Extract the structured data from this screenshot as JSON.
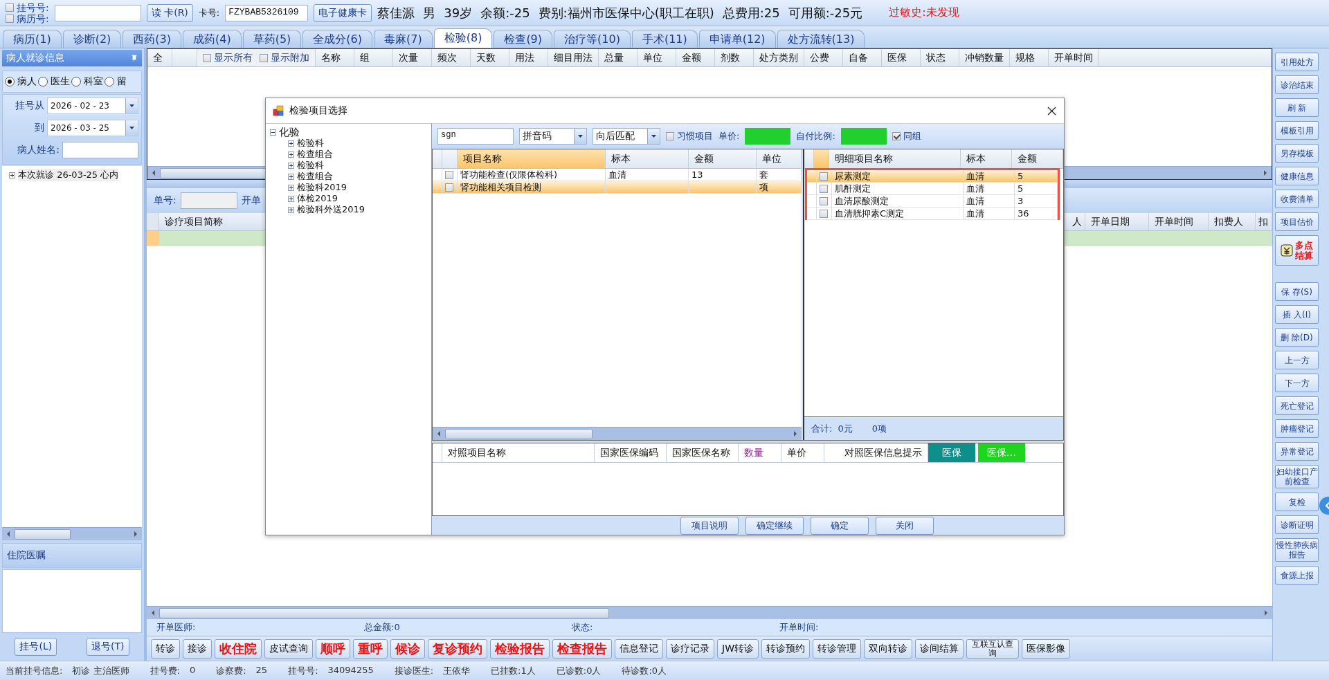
{
  "top_bar": {
    "checkboxes": [
      {
        "label": "挂号号:",
        "checked": false
      },
      {
        "label": "病历号:",
        "checked": false
      }
    ],
    "read_card_button": "读 卡(R)",
    "card_label": "卡号:",
    "card_number": "FZYBAB5326109",
    "health_card_button": "电子健康卡",
    "info_items": [
      "蔡佳源",
      "男",
      "39岁",
      "余额:-25",
      "费别:福州市医保中心(职工在职)",
      "总费用:25",
      "可用额:-25元"
    ],
    "allergy": "过敏史:未发现"
  },
  "tabs": [
    {
      "label": "病历(1)",
      "selected": false
    },
    {
      "label": "诊断(2)",
      "selected": false
    },
    {
      "label": "西药(3)",
      "selected": false
    },
    {
      "label": "成药(4)",
      "selected": false
    },
    {
      "label": "草药(5)",
      "selected": false
    },
    {
      "label": "全成分(6)",
      "selected": false
    },
    {
      "label": "毒麻(7)",
      "selected": false
    },
    {
      "label": "检验(8)",
      "selected": true
    },
    {
      "label": "检查(9)",
      "selected": false
    },
    {
      "label": "治疗等(10)",
      "selected": false
    },
    {
      "label": "手术(11)",
      "selected": false
    },
    {
      "label": "申请单(12)",
      "selected": false
    },
    {
      "label": "处方流转(13)",
      "selected": false
    }
  ],
  "left_panel": {
    "title": "病人就诊信息",
    "radios": [
      {
        "label": "病人",
        "selected": true
      },
      {
        "label": "医生",
        "selected": false
      },
      {
        "label": "科室",
        "selected": false
      },
      {
        "label": "留",
        "selected": false
      }
    ],
    "date_from_label": "挂号从",
    "date_from": "2026 - 02 - 23",
    "date_to_label": "到",
    "date_to": "2026 - 03 - 25",
    "name_label": "病人姓名:",
    "tree": [
      {
        "label": "本次就诊  26-03-25  心内",
        "expanded": false
      }
    ],
    "inpatient_title": "住院医嘱",
    "buttons": [
      "挂号(L)",
      "退号(T)"
    ]
  },
  "prescription_grid": {
    "select_all": "全",
    "toggles": [
      {
        "label": "显示所有",
        "checked": false
      },
      {
        "label": "显示附加",
        "checked": false
      }
    ],
    "columns": [
      "名称",
      "组",
      "次量",
      "频次",
      "天数",
      "用法",
      "细目用法",
      "总量",
      "单位",
      "金额",
      "剂数",
      "处方类别",
      "公费",
      "自备",
      "医保",
      "状态",
      "冲销数量",
      "规格",
      "开单时间"
    ]
  },
  "order_panel": {
    "number_label": "单号:",
    "doctor_label": "开单",
    "columns_left": [
      "诊疗项目简称"
    ],
    "columns_right": [
      "人",
      "开单日期",
      "开单时间",
      "扣费人",
      "扣"
    ],
    "rows": [
      {
        "selected": true
      }
    ],
    "summary": [
      "开单医师:",
      "总金额:0",
      "状态:",
      "开单时间:"
    ]
  },
  "action_buttons": [
    {
      "label": "转诊",
      "kind": "normal"
    },
    {
      "label": "接诊",
      "kind": "normal"
    },
    {
      "label": "收住院",
      "kind": "emphasis"
    },
    {
      "label": "皮试查询",
      "kind": "normal"
    },
    {
      "label": "顺呼",
      "kind": "emphasis"
    },
    {
      "label": "重呼",
      "kind": "emphasis"
    },
    {
      "label": "候诊",
      "kind": "emphasis"
    },
    {
      "label": "复诊预约",
      "kind": "emphasis"
    },
    {
      "label": "检验报告",
      "kind": "emphasis"
    },
    {
      "label": "检查报告",
      "kind": "emphasis"
    },
    {
      "label": "信息登记",
      "kind": "normal"
    },
    {
      "label": "诊疗记录",
      "kind": "normal"
    },
    {
      "label": "JW转诊",
      "kind": "normal"
    },
    {
      "label": "转诊预约",
      "kind": "normal"
    },
    {
      "label": "转诊管理",
      "kind": "normal"
    },
    {
      "label": "双向转诊",
      "kind": "normal"
    },
    {
      "label": "诊间结算",
      "kind": "normal"
    },
    {
      "label": "互联互认查询",
      "kind": "small"
    },
    {
      "label": "医保影像",
      "kind": "normal"
    }
  ],
  "side_buttons": [
    {
      "label": "引用处方",
      "kind": "button"
    },
    {
      "label": "诊治结束",
      "kind": "button"
    },
    {
      "label": "刷 新",
      "kind": "button"
    },
    {
      "label": "模板引用",
      "kind": "button"
    },
    {
      "label": "另存模板",
      "kind": "button"
    },
    {
      "label": "健康信息",
      "kind": "button"
    },
    {
      "label": "收费清单",
      "kind": "button"
    },
    {
      "label": "项目估价",
      "kind": "button"
    },
    {
      "label": "多点结算",
      "kind": "icon_button"
    },
    {
      "label": "保 存(S)",
      "kind": "button"
    },
    {
      "label": "插 入(I)",
      "kind": "button"
    },
    {
      "label": "删 除(D)",
      "kind": "button"
    },
    {
      "label": "上一方",
      "kind": "button"
    },
    {
      "label": "下一方",
      "kind": "button"
    },
    {
      "label": "死亡登记",
      "kind": "button"
    },
    {
      "label": "肿瘤登记",
      "kind": "button"
    },
    {
      "label": "异常登记",
      "kind": "button"
    },
    {
      "label": "妇幼接口产前检查",
      "kind": "button"
    },
    {
      "label": "复检",
      "kind": "button"
    },
    {
      "label": "诊断证明",
      "kind": "button"
    },
    {
      "label": "慢性肺疾病报告",
      "kind": "button"
    },
    {
      "label": "食源上报",
      "kind": "button"
    }
  ],
  "status_bar": [
    {
      "label": "当前挂号信息:",
      "value": "初诊 主治医师"
    },
    {
      "label": "挂号费:",
      "value": "0"
    },
    {
      "label": "诊察费:",
      "value": "25"
    },
    {
      "label": "挂号号:",
      "value": "34094255"
    },
    {
      "label": "接诊医生:",
      "value": "王依华"
    },
    {
      "label": "已挂数:1人"
    },
    {
      "label": "已诊数:0人"
    },
    {
      "label": "待诊数:0人"
    }
  ],
  "dialog": {
    "title": "检验项目选择",
    "tree": [
      {
        "label": "化验",
        "expanded": true,
        "children": [
          {
            "label": "检验科",
            "expanded": false
          },
          {
            "label": "检查组合",
            "expanded": false
          },
          {
            "label": "检验科",
            "expanded": false
          },
          {
            "label": "检查组合",
            "expanded": false
          },
          {
            "label": "检验科2019",
            "expanded": false
          },
          {
            "label": "体检2019",
            "expanded": false
          },
          {
            "label": "检验科外送2019",
            "expanded": false
          }
        ]
      }
    ],
    "search": {
      "value": "sgn"
    },
    "code_type": "拼音码",
    "match_mode": "向后匹配",
    "habit_checkbox": {
      "label": "习惯项目",
      "checked": false
    },
    "price_label": "单价:",
    "ratio_label": "自付比例:",
    "group_checkbox": {
      "label": "同组",
      "checked": true
    },
    "item_columns": [
      "项目名称",
      "标本",
      "金额",
      "单位"
    ],
    "items": [
      {
        "name": "肾功能检查(仅限体检科)",
        "specimen": "血清",
        "amount": "13",
        "unit": "套",
        "checked": false,
        "selected": false
      },
      {
        "name": "肾功能相关项目检测",
        "unit": "项",
        "checked": false,
        "selected": true
      }
    ],
    "detail_columns": [
      "明细项目名称",
      "标本",
      "金额"
    ],
    "details_highlighted": true,
    "details": [
      {
        "name": "尿素测定",
        "specimen": "血清",
        "amount": "5",
        "checked": false,
        "selected": true
      },
      {
        "name": "肌酐测定",
        "specimen": "血清",
        "amount": "5",
        "checked": false,
        "selected": false
      },
      {
        "name": "血清尿酸测定",
        "specimen": "血清",
        "amount": "3",
        "checked": false,
        "selected": false
      },
      {
        "name": "血清胱抑素C测定",
        "specimen": "血清",
        "amount": "36",
        "checked": false,
        "selected": false
      }
    ],
    "total_label": "合计:",
    "total_amount": "0元",
    "total_count": "0项",
    "mapping_columns": [
      {
        "label": "对照项目名称",
        "emphasis": false
      },
      {
        "label": "国家医保编码",
        "emphasis": false
      },
      {
        "label": "国家医保名称",
        "emphasis": false
      },
      {
        "label": "数量",
        "emphasis": true
      },
      {
        "label": "单价",
        "emphasis": false
      },
      {
        "label": "对照医保信息提示",
        "emphasis": false
      }
    ],
    "mapping_tags": [
      {
        "label": "医保",
        "color": "#0f8f8c"
      },
      {
        "label": "医保…",
        "color": "#1fd51f"
      }
    ],
    "buttons": [
      "项目说明",
      "确定继续",
      "确定",
      "关闭"
    ]
  }
}
